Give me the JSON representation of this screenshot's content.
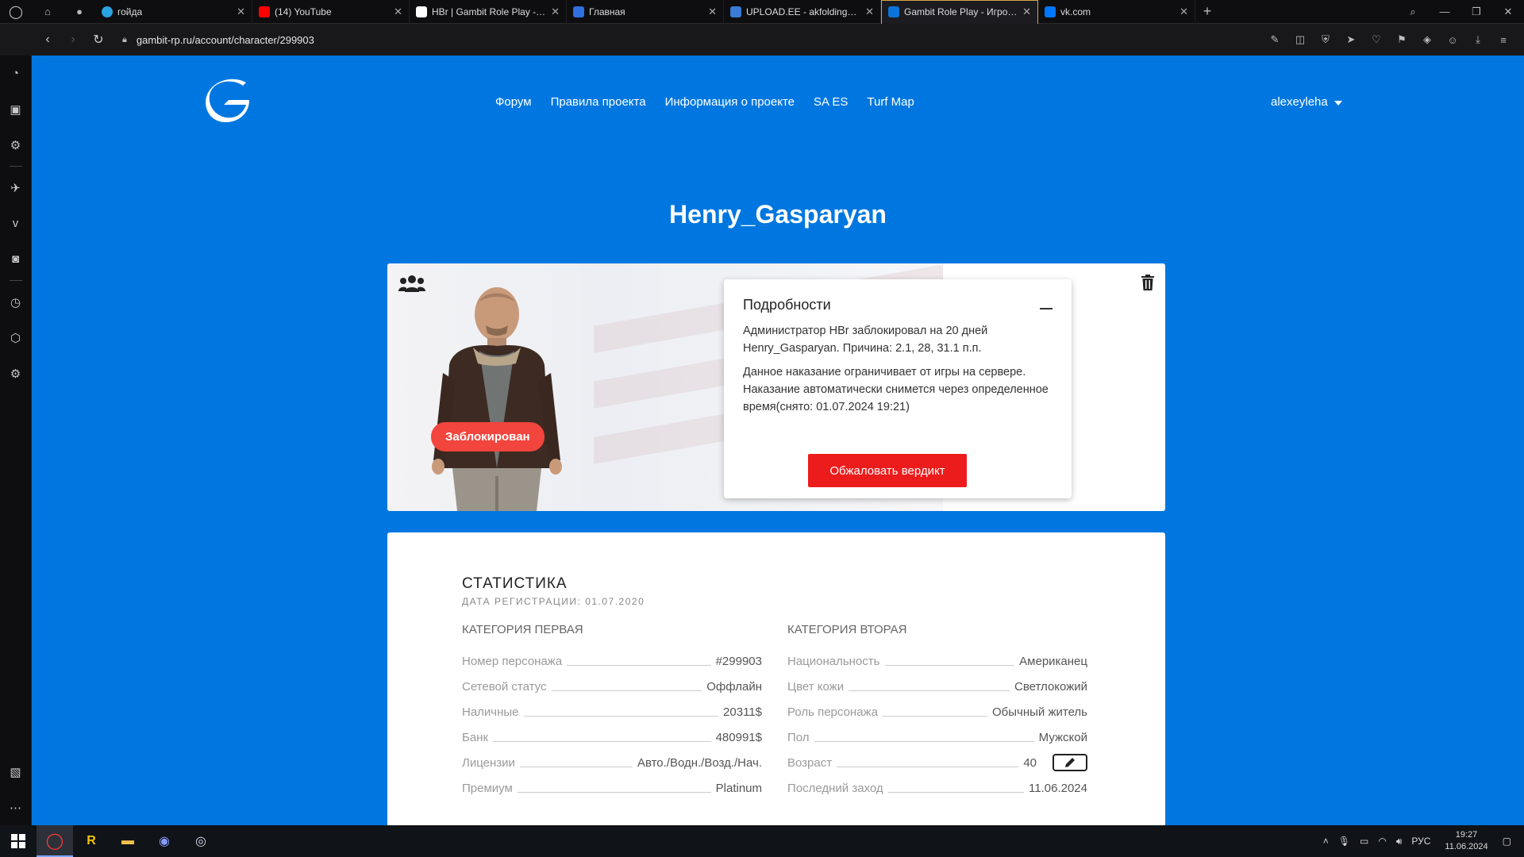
{
  "browser": {
    "tabs": [
      {
        "title": "гойда",
        "favicon_color": "#2aa3e0",
        "active": false
      },
      {
        "title": "(14) YouTube",
        "favicon_color": "#ff0000",
        "active": false
      },
      {
        "title": "HBr | Gambit Role Play - Фо",
        "favicon_color": "#ffffff",
        "active": false
      },
      {
        "title": "Главная",
        "favicon_color": "#2f6fe0",
        "active": false
      },
      {
        "title": "UPLOAD.EE - akfoldingstoc",
        "favicon_color": "#3a7bd5",
        "active": false
      },
      {
        "title": "Gambit Role Play - Игрово",
        "favicon_color": "#0a74da",
        "active": true
      },
      {
        "title": "vk.com",
        "favicon_color": "#0077ff",
        "active": false
      }
    ],
    "new_tab": "+",
    "url": "gambit-rp.ru/account/character/299903"
  },
  "site": {
    "nav": [
      "Форум",
      "Правила проекта",
      "Информация о проекте",
      "SA ES",
      "Turf Map"
    ],
    "username": "alexeyleha",
    "character_name": "Henry_Gasparyan",
    "status_badge": "Заблокирован",
    "details": {
      "title": "Подробности",
      "text1": "Администратор HBr заблокировал на 20 дней Henry_Gasparyan. Причина: 2.1, 28, 31.1 п.п.",
      "text2": "Данное наказание ограничивает от игры на сервере. Наказание автоматически снимется через определенное время(снято: 01.07.2024 19:21)",
      "appeal_button": "Обжаловать вердикт"
    },
    "stats": {
      "title": "СТАТИСТИКА",
      "reg_date": "ДАТА РЕГИСТРАЦИИ: 01.07.2020",
      "cat1_title": "КАТЕГОРИЯ ПЕРВАЯ",
      "cat2_title": "КАТЕГОРИЯ ВТОРАЯ",
      "cat1": [
        {
          "label": "Номер персонажа",
          "value": "#299903"
        },
        {
          "label": "Сетевой статус",
          "value": "Оффлайн"
        },
        {
          "label": "Наличные",
          "value": "20311$"
        },
        {
          "label": "Банк",
          "value": "480991$"
        },
        {
          "label": "Лицензии",
          "value": "Авто./Водн./Возд./Нач."
        },
        {
          "label": "Премиум",
          "value": "Platinum"
        }
      ],
      "cat2": [
        {
          "label": "Национальность",
          "value": "Американец"
        },
        {
          "label": "Цвет кожи",
          "value": "Светлокожий"
        },
        {
          "label": "Роль персонажа",
          "value": "Обычный житель"
        },
        {
          "label": "Пол",
          "value": "Мужской"
        },
        {
          "label": "Возраст",
          "value": "40"
        },
        {
          "label": "Последний заход",
          "value": "11.06.2024"
        }
      ]
    }
  },
  "taskbar": {
    "lang": "РУС",
    "time": "19:27",
    "date": "11.06.2024"
  },
  "colors": {
    "brand_blue": "#0077e0",
    "badge_red": "#f2453d",
    "button_red": "#ec1c1c"
  }
}
